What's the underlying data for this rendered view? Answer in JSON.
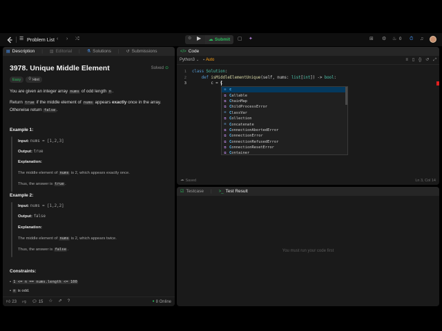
{
  "topbar": {
    "problem_list": "Problem List",
    "submit": "Submit",
    "coins": "0"
  },
  "description": {
    "tabs": [
      "Description",
      "Editorial",
      "Solutions",
      "Submissions"
    ],
    "title": "3978. Unique Middle Element",
    "solved": "Solved",
    "difficulty": "Easy",
    "hint": "Hint",
    "statement_1_a": "You are given an integer array ",
    "statement_1_code": "nums",
    "statement_1_b": " of odd length ",
    "statement_1_code2": "n",
    "statement_1_c": ".",
    "statement_2_a": "Return ",
    "statement_2_code": "true",
    "statement_2_b": " if the middle element of ",
    "statement_2_code2": "nums",
    "statement_2_c": " appears ",
    "statement_2_bold": "exactly",
    "statement_2_d": " once in the array. Otherwise return ",
    "statement_2_code3": "false",
    "statement_2_e": ".",
    "examples": [
      {
        "heading": "Example 1:",
        "input_label": "Input:",
        "input": "nums = [1,2,3]",
        "output_label": "Output:",
        "output": "true",
        "explanation_label": "Explanation:",
        "explanation_a": "The middle element of ",
        "explanation_code": "nums",
        "explanation_b": " is 2, which appears exactly once.",
        "answer_a": "Thus, the answer is ",
        "answer_code": "true",
        "answer_b": "."
      },
      {
        "heading": "Example 2:",
        "input_label": "Input:",
        "input": "nums = [1,2,2]",
        "output_label": "Output:",
        "output": "false",
        "explanation_label": "Explanation:",
        "explanation_a": "The middle element of ",
        "explanation_code": "nums",
        "explanation_b": " is 2, which appears twice.",
        "answer_a": "Thus, the answer is ",
        "answer_code": "false",
        "answer_b": "."
      }
    ],
    "constraints_heading": "Constraints:",
    "constraint_1": "1 <= n == nums.length <= 100",
    "constraint_2_code": "n",
    "constraint_2_text": " is odd.",
    "footer": {
      "likes": "23",
      "comments": "15",
      "online": "8 Online"
    }
  },
  "code": {
    "title": "Code",
    "language": "Python3",
    "auto": "Auto",
    "lines": [
      {
        "n": "1",
        "parts": [
          [
            "kw",
            "class "
          ],
          [
            "ty",
            "Solution"
          ],
          [
            "",
            ":"
          ]
        ]
      },
      {
        "n": "2",
        "parts": [
          [
            "",
            "    "
          ],
          [
            "kw",
            "def "
          ],
          [
            "fn",
            "isMiddleElementUnique"
          ],
          [
            "",
            "(self, nums: "
          ],
          [
            "ty",
            "list"
          ],
          [
            "",
            "["
          ],
          [
            "ty",
            "int"
          ],
          [
            "",
            "]) -> "
          ],
          [
            "ty",
            "bool"
          ],
          [
            "",
            ":"
          ]
        ]
      },
      {
        "n": "3",
        "parts": [
          [
            "",
            "        c = C"
          ]
        ]
      }
    ],
    "autocomplete": [
      {
        "kind": "[x]",
        "label": "c"
      },
      {
        "kind": "cls",
        "label": "Callable"
      },
      {
        "kind": "cls",
        "label": "ChainMap"
      },
      {
        "kind": "cls",
        "label": "ChildProcessError"
      },
      {
        "kind": "[x]",
        "label": "ClassVar"
      },
      {
        "kind": "cls",
        "label": "Collection"
      },
      {
        "kind": "[x]",
        "label": "Concatenate"
      },
      {
        "kind": "cls",
        "label": "ConnectionAbortedError"
      },
      {
        "kind": "cls",
        "label": "ConnectionError"
      },
      {
        "kind": "cls",
        "label": "ConnectionRefusedError"
      },
      {
        "kind": "cls",
        "label": "ConnectionResetError"
      },
      {
        "kind": "cls",
        "label": "Container"
      }
    ],
    "saved": "Saved",
    "cursor_pos": "Ln 3, Col 14"
  },
  "bottom": {
    "tabs": [
      "Testcase",
      "Test Result"
    ],
    "empty": "You must run your code first"
  },
  "colors": {
    "accent_green": "#2cbb5d",
    "auto_orange": "#ffa116",
    "panel": "#1a1a1a",
    "panel_header": "#262626"
  }
}
